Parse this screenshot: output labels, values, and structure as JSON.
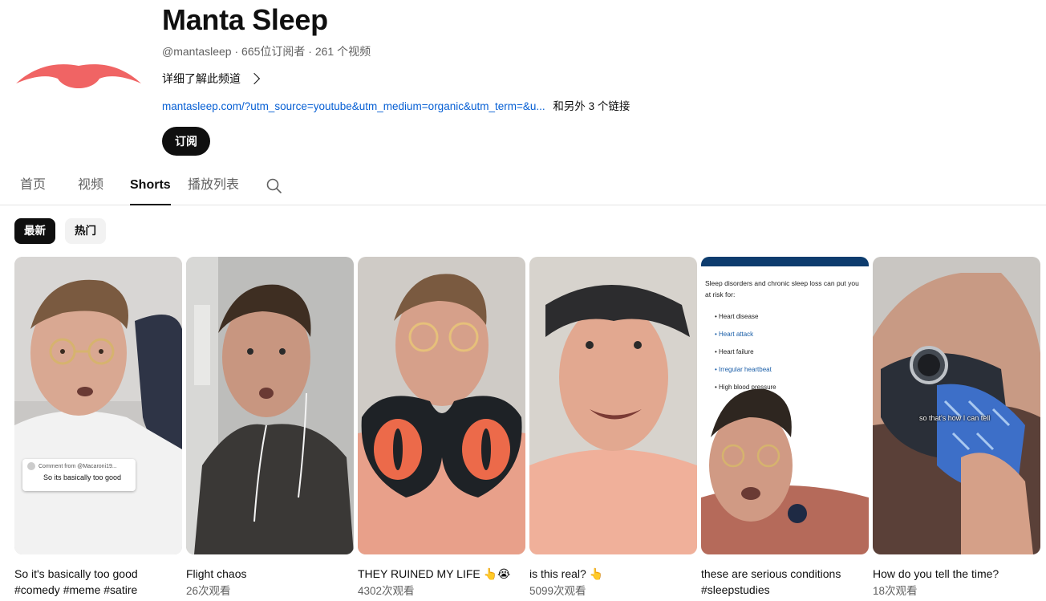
{
  "channel": {
    "name": "Manta Sleep",
    "handle": "@mantasleep",
    "subscribers": "665位订阅者",
    "videos": "261 个视频",
    "about_label": "详细了解此频道",
    "link_url": "mantasleep.com/?utm_source=youtube&utm_medium=organic&utm_term=&u...",
    "link_more": "和另外 3 个链接",
    "subscribe_label": "订阅",
    "brand_color": "#f06464"
  },
  "tabs": [
    {
      "label": "首页",
      "active": false
    },
    {
      "label": "视频",
      "active": false
    },
    {
      "label": "Shorts",
      "active": true
    },
    {
      "label": "播放列表",
      "active": false
    }
  ],
  "chips": [
    {
      "label": "最新",
      "active": true
    },
    {
      "label": "热门",
      "active": false
    }
  ],
  "shorts": [
    {
      "title": "So it's basically too good #comedy #meme #satire",
      "views": "",
      "overlay_comment_from": "Comment from @Macaroni19...",
      "overlay_comment": "So its basically too good"
    },
    {
      "title": "Flight chaos",
      "views": "26次观看"
    },
    {
      "title": "THEY RUINED MY LIFE 👆😭",
      "views": "4302次观看"
    },
    {
      "title": "is this real? 👆",
      "views": "5099次观看"
    },
    {
      "title": "these are serious conditions #sleepstudies",
      "views": "",
      "overlay_heading": "Sleep disorders and chronic sleep loss can put you at risk for:",
      "overlay_list": [
        "Heart disease",
        "Heart attack",
        "Heart failure",
        "Irregular heartbeat",
        "High blood pressure"
      ]
    },
    {
      "title": "How do you tell the time?",
      "views": "18次观看",
      "overlay_caption": "so that's how I can tell"
    }
  ]
}
